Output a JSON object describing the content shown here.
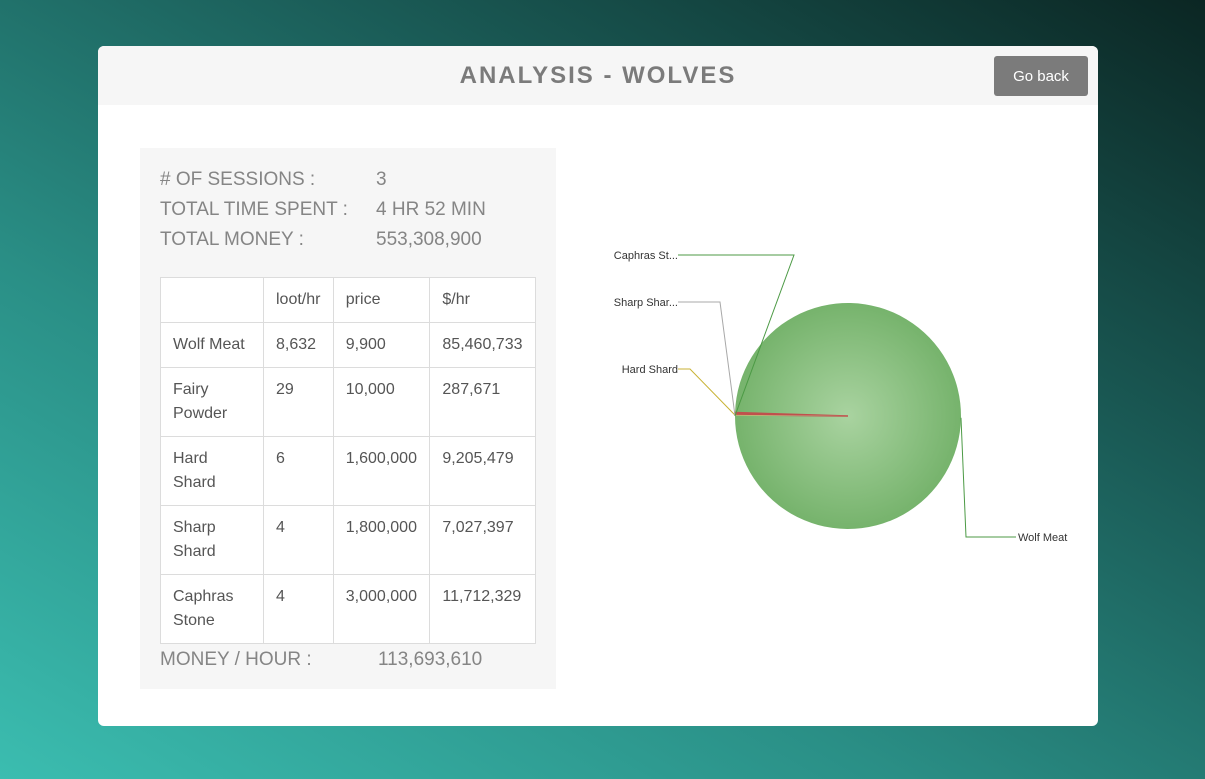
{
  "header": {
    "title": "ANALYSIS - WOLVES",
    "back_label": "Go back"
  },
  "summary": {
    "sessions_label": "# OF SESSIONS :",
    "sessions_value": "3",
    "time_label": "TOTAL TIME SPENT :",
    "time_value": "4 HR 52 MIN",
    "money_label": "TOTAL MONEY :",
    "money_value": "553,308,900"
  },
  "table": {
    "headers": [
      "",
      "loot/hr",
      "price",
      "$/hr"
    ],
    "rows": [
      {
        "name": "Wolf Meat",
        "loot": "8,632",
        "price": "9,900",
        "rate": "85,460,733"
      },
      {
        "name": "Fairy Powder",
        "loot": "29",
        "price": "10,000",
        "rate": "287,671"
      },
      {
        "name": "Hard Shard",
        "loot": "6",
        "price": "1,600,000",
        "rate": "9,205,479"
      },
      {
        "name": "Sharp Shard",
        "loot": "4",
        "price": "1,800,000",
        "rate": "7,027,397"
      },
      {
        "name": "Caphras Stone",
        "loot": "4",
        "price": "3,000,000",
        "rate": "11,712,329"
      }
    ]
  },
  "money_per_hour": {
    "label": "MONEY / HOUR :",
    "value": "113,693,610"
  },
  "chart_data": {
    "type": "pie",
    "slices": [
      {
        "label": "Wolf Meat",
        "value": 8632,
        "color": "#7cb773"
      },
      {
        "label": "Fairy Powder",
        "value": 29,
        "color": "#c0504d"
      },
      {
        "label": "Hard Shard",
        "value": 6,
        "color": "#e2cf5e"
      },
      {
        "label": "Sharp Shar...",
        "value": 4,
        "color": "#cfcfcf"
      },
      {
        "label": "Caphras St...",
        "value": 4,
        "color": "#7cb773"
      }
    ],
    "legend": "none"
  }
}
